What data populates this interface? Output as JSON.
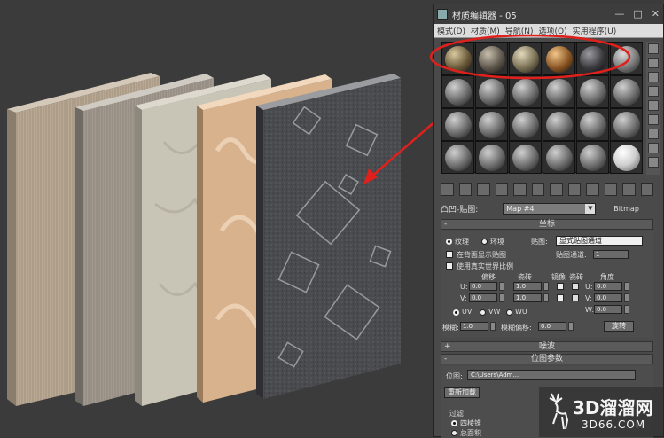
{
  "window": {
    "title": "材质编辑器 - 05",
    "controls": [
      "—",
      "□",
      "✕"
    ]
  },
  "menubar": [
    "模式(D)",
    "材质(M)",
    "导航(N)",
    "选项(O)",
    "实用程序(U)"
  ],
  "toolbar_icons": [
    "get-material-icon",
    "put-to-scene-icon",
    "assign-material-icon",
    "reset-icon",
    "copy-icon",
    "unique-icon",
    "put-library-icon",
    "material-id-icon",
    "show-map-icon",
    "show-end-icon",
    "go-parent-icon",
    "go-forward-icon"
  ],
  "map_row": {
    "label": "凸凹-贴图:",
    "map_name": "Map #4",
    "map_type": "Bitmap"
  },
  "coordinates": {
    "header": "坐标",
    "texture_label": "纹理",
    "environ_label": "环境",
    "mapping_label": "贴图:",
    "mapping_value": "显式贴图通道",
    "show_on_back": "在背面显示贴图",
    "map_channel_label": "贴图通道:",
    "map_channel_value": "1",
    "real_world": "使用真实世界比例",
    "offset_label": "偏移",
    "tiling_label": "瓷砖",
    "mirror_label": "镜像",
    "tile_label": "瓷砖",
    "angle_label": "角度",
    "u_label": "U:",
    "v_label": "V:",
    "w_label": "W:",
    "u_offset": "0.0",
    "v_offset": "0.0",
    "u_tiling": "1.0",
    "v_tiling": "1.0",
    "u_angle": "0.0",
    "v_angle": "0.0",
    "w_angle": "0.0",
    "uv": "UV",
    "vw": "VW",
    "wu": "WU",
    "blur_label": "模糊:",
    "blur_value": "1.0",
    "blur_offset_label": "模糊偏移:",
    "blur_offset_value": "0.0",
    "rotate_button": "旋转"
  },
  "noise": {
    "header": "噪波"
  },
  "bitmap_params": {
    "header": "位图参数",
    "path_label": "位图:",
    "path_value": "C:\\Users\\Adm...",
    "reload_button": "重新加载",
    "filter_label": "过滤",
    "pyramidal": "四棱锥",
    "summed_area": "总面积"
  },
  "watermark": {
    "big": "3D溜溜网",
    "small": "3D66.COM"
  },
  "colors": {
    "annotation_red": "#e0201c"
  }
}
